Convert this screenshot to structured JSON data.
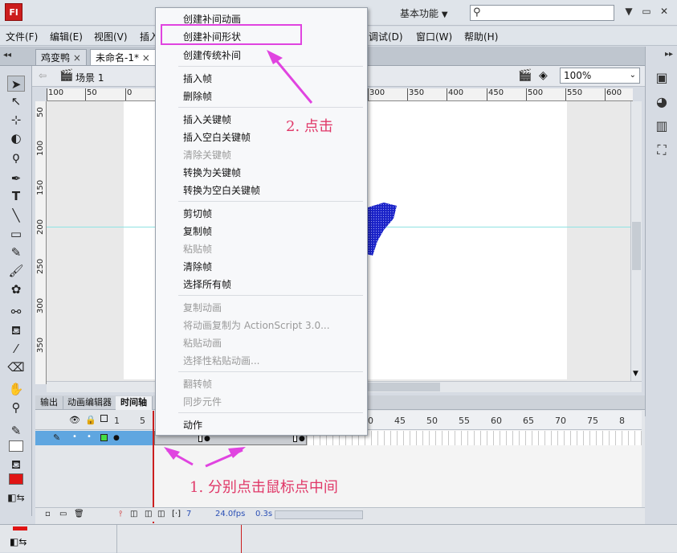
{
  "app": {
    "logo_text": "Fl",
    "workspace": "基本功能",
    "workspace_arrow": "▼"
  },
  "window": {
    "min": "▼",
    "restore": "▭",
    "close": "✕"
  },
  "menubar": [
    "文件(F)",
    "编辑(E)",
    "视图(V)",
    "插入",
    "调试(D)",
    "窗口(W)",
    "帮助(H)"
  ],
  "tabs": [
    {
      "label": "鸡变鸭",
      "close": "×"
    },
    {
      "label": "未命名-1*",
      "close": "×"
    }
  ],
  "editbar": {
    "scene_label": "场景 1",
    "zoom": "100%"
  },
  "ruler": {
    "h_ticks": [
      "100",
      "50",
      "0",
      "300",
      "350",
      "400",
      "450",
      "500",
      "550",
      "600"
    ],
    "v_ticks": [
      "50",
      "100",
      "150",
      "200",
      "250",
      "300",
      "350"
    ]
  },
  "timeline": {
    "tabs": [
      "输出",
      "动画编辑器",
      "时间轴"
    ],
    "frame_numbers": [
      "1",
      "5",
      "40",
      "45",
      "50",
      "55",
      "60",
      "65",
      "70",
      "75",
      "8"
    ],
    "current_frame": "7",
    "fps": "24.0fps",
    "time": "0.3s"
  },
  "context_menu": {
    "items": [
      {
        "label": "创建补间动画",
        "disabled": false
      },
      {
        "label": "创建补间形状",
        "disabled": false
      },
      {
        "label": "创建传统补间",
        "disabled": false
      },
      {
        "label": "插入帧",
        "disabled": false
      },
      {
        "label": "删除帧",
        "disabled": false
      },
      {
        "label": "插入关键帧",
        "disabled": false
      },
      {
        "label": "插入空白关键帧",
        "disabled": false
      },
      {
        "label": "清除关键帧",
        "disabled": true
      },
      {
        "label": "转换为关键帧",
        "disabled": false
      },
      {
        "label": "转换为空白关键帧",
        "disabled": false
      },
      {
        "label": "剪切帧",
        "disabled": false
      },
      {
        "label": "复制帧",
        "disabled": false
      },
      {
        "label": "粘贴帧",
        "disabled": true
      },
      {
        "label": "清除帧",
        "disabled": false
      },
      {
        "label": "选择所有帧",
        "disabled": false
      },
      {
        "label": "复制动画",
        "disabled": true
      },
      {
        "label": "将动画复制为 ActionScript 3.0...",
        "disabled": true
      },
      {
        "label": "粘贴动画",
        "disabled": true
      },
      {
        "label": "选择性粘贴动画...",
        "disabled": true
      },
      {
        "label": "翻转帧",
        "disabled": true
      },
      {
        "label": "同步元件",
        "disabled": true
      },
      {
        "label": "动作",
        "disabled": false
      }
    ]
  },
  "annotations": {
    "step1": "1. 分别点击鼠标点中间",
    "step2": "2. 点击"
  },
  "colors": {
    "highlight": "#e044e0",
    "annotation": "#e03868",
    "shape_fill": "#1a22c8",
    "playhead": "#cc1f1f",
    "layer_selected": "#5fa6e0"
  }
}
